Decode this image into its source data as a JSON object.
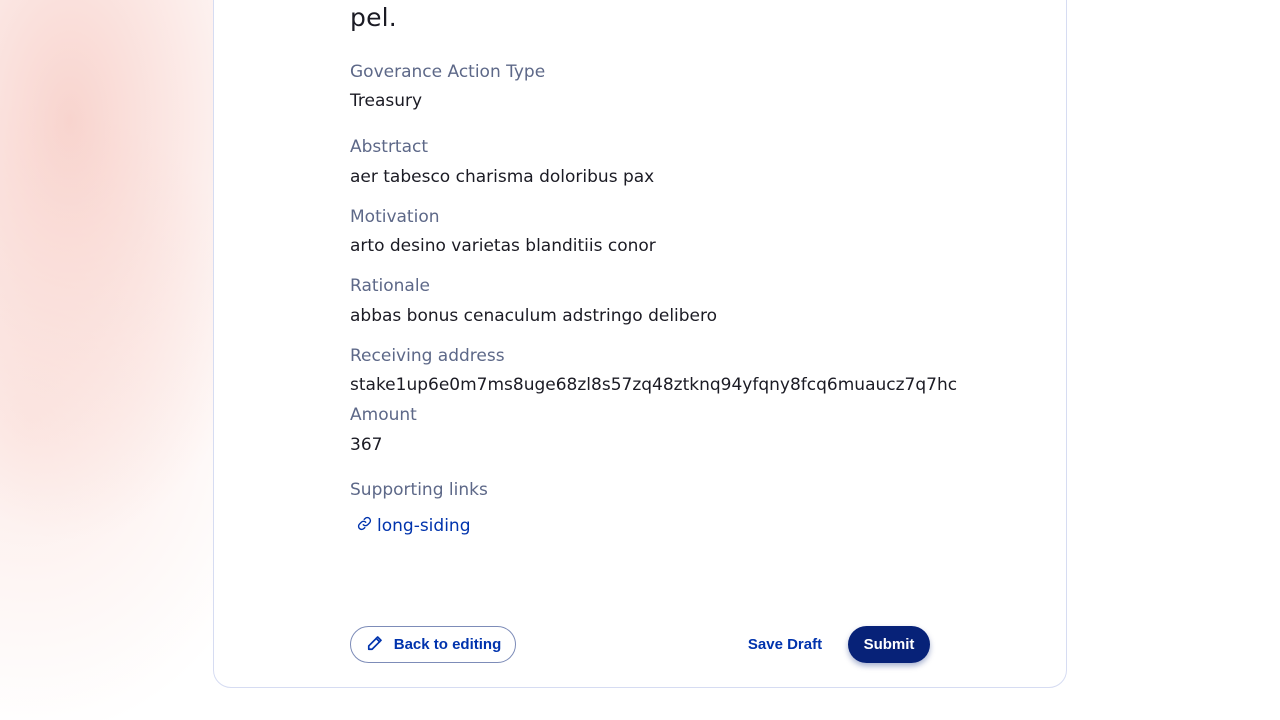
{
  "proposal": {
    "title_tail": "pel.",
    "fields": [
      {
        "label": "Goverance Action Type",
        "value": "Treasury"
      },
      {
        "label": "Abstrtact",
        "value": "aer tabesco charisma doloribus pax"
      },
      {
        "label": "Motivation",
        "value": "arto desino varietas blanditiis conor"
      },
      {
        "label": "Rationale",
        "value": "abbas bonus cenaculum adstringo delibero"
      },
      {
        "label": "Receiving address",
        "value": "stake1up6e0m7ms8uge68zl8s57zq48ztknq94yfqny8fcq6muaucz7q7hc"
      },
      {
        "label": "Amount",
        "value": "367"
      }
    ],
    "supporting_links_label": "Supporting links",
    "links": [
      "long-siding"
    ]
  },
  "actions": {
    "back_label": "Back to editing",
    "draft_label": "Save Draft",
    "submit_label": "Submit"
  },
  "colors": {
    "accent": "#0033ad",
    "submit_bg": "#072278",
    "label": "#5d6888",
    "text": "#1b1b24"
  },
  "icons": {
    "link": "link-icon",
    "edit": "pencil-icon"
  }
}
